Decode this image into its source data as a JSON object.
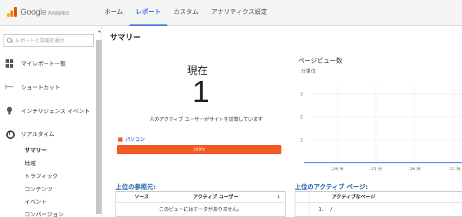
{
  "app": {
    "logo_text": "Google",
    "logo_sub": "Analytics"
  },
  "nav": {
    "tabs": [
      {
        "label": "ホーム",
        "active": false
      },
      {
        "label": "レポート",
        "active": true
      },
      {
        "label": "カスタム",
        "active": false
      },
      {
        "label": "アナリティクス設定",
        "active": false
      }
    ]
  },
  "sidebar": {
    "search_placeholder": "レポートと詳細を表示",
    "collapse_glyph": "◂",
    "items": [
      {
        "label": "マイレポート一覧",
        "icon": "grid-icon"
      },
      {
        "label": "ショートカット",
        "icon": "shortcut-arrow-icon"
      },
      {
        "label": "インテリジェンス イベント",
        "icon": "lightbulb-icon"
      },
      {
        "label": "リアルタイム",
        "icon": "clock-icon"
      }
    ],
    "sub_items": [
      {
        "label": "サマリー",
        "active": true
      },
      {
        "label": "地域",
        "active": false
      },
      {
        "label": "トラフィック",
        "active": false
      },
      {
        "label": "コンテンツ",
        "active": false
      },
      {
        "label": "イベント",
        "active": false
      },
      {
        "label": "コンバージョン",
        "active": false
      }
    ]
  },
  "main": {
    "title": "サマリー",
    "now": {
      "label": "現在",
      "count": "1",
      "description": "人のアクティブ ユーザーがサイトを訪問しています"
    },
    "device": {
      "name": "パソコン",
      "percent_label": "100%",
      "percent": 100,
      "color": "#f15a24"
    },
    "pageviews": {
      "title": "ページビュー数",
      "subtitle": "分単位"
    },
    "referrers": {
      "title": "上位の参照元:",
      "col_source": "ソース",
      "col_active": "アクティブ ユーザー",
      "sort_glyph": "↓",
      "empty_text": "このビューにはデータがありません。"
    },
    "active_pages": {
      "title": "上位のアクティブ ページ:",
      "col_page": "アクティブなページ",
      "rows": [
        {
          "index": "1.",
          "page": "/"
        }
      ]
    }
  },
  "chart_data": {
    "type": "bar",
    "title": "ページビュー数",
    "subtitle": "分単位",
    "x_tick_labels": [
      "-26 分",
      "-21 分",
      "-16 分",
      "-11 分"
    ],
    "y_tick_labels": [
      "1",
      "2",
      "3"
    ],
    "ylim": [
      0,
      3
    ],
    "values": [],
    "grid": true,
    "axis_color": "#3b78e7"
  }
}
